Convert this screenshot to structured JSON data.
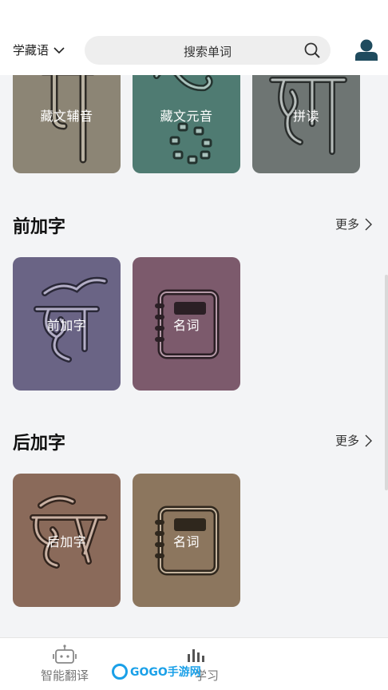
{
  "header": {
    "language_selector": "学藏语",
    "search_placeholder": "搜索单词"
  },
  "top_row": {
    "cards": [
      {
        "label": "藏文辅音",
        "color": "#8c8575"
      },
      {
        "label": "藏文元音",
        "color": "#4f7b72"
      },
      {
        "label": "拼读",
        "color": "#6e7573"
      }
    ]
  },
  "sections": [
    {
      "title": "前加字",
      "more": "更多",
      "cards": [
        {
          "label": "前加字",
          "color": "#6a6485"
        },
        {
          "label": "名词",
          "color": "#7c5a6c"
        }
      ]
    },
    {
      "title": "后加字",
      "more": "更多",
      "cards": [
        {
          "label": "后加字",
          "color": "#8a6a5a"
        },
        {
          "label": "名词",
          "color": "#8c765e"
        }
      ]
    }
  ],
  "bottom_nav": {
    "items": [
      {
        "label": "智能翻译",
        "icon": "robot-icon"
      },
      {
        "label": "学习",
        "icon": "bar-chart-icon"
      }
    ],
    "watermark": "GOGO手游网"
  }
}
